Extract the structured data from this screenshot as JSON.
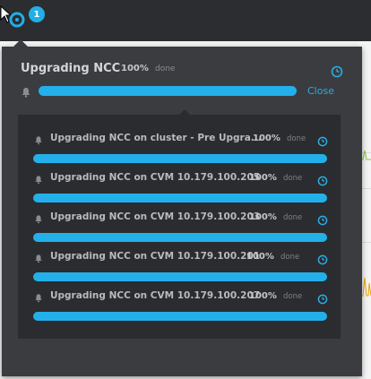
{
  "topbar": {
    "notification_count": "1",
    "icons": [
      "cursor-arrow",
      "task-status-icon"
    ]
  },
  "header": {
    "title": "Upgrading NCC",
    "percent": "100%",
    "status": "done",
    "progress": 1.0,
    "close_label": "Close"
  },
  "tasks": [
    {
      "name": "Upgrading NCC on cluster - Pre Upgra...",
      "percent": "100%",
      "status": "done",
      "progress": 1.0
    },
    {
      "name": "Upgrading NCC on CVM 10.179.100.205",
      "percent": "100%",
      "status": "done",
      "progress": 1.0
    },
    {
      "name": "Upgrading NCC on CVM 10.179.100.203",
      "percent": "100%",
      "status": "done",
      "progress": 1.0
    },
    {
      "name": "Upgrading NCC on CVM 10.179.100.201",
      "percent": "100%",
      "status": "done",
      "progress": 1.0
    },
    {
      "name": "Upgrading NCC on CVM 10.179.100.207",
      "percent": "100%",
      "status": "done",
      "progress": 1.0
    }
  ],
  "colors": {
    "accent": "#23b0ea",
    "panel": "#3a3c40",
    "tasks_bg": "#2a2c2f",
    "topbar": "#2b2d30"
  }
}
